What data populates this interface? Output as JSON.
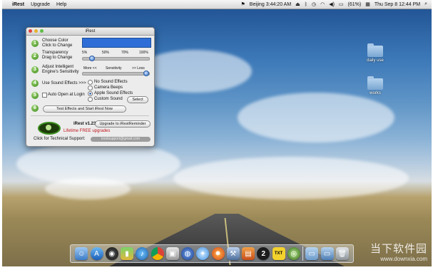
{
  "menubar": {
    "app": "iRest",
    "items": [
      "Upgrade",
      "Help"
    ],
    "clock_city": "Beijing 3:44:20 AM",
    "battery": "(61%)",
    "datetime": "Thu Sep 8  12:44 PM"
  },
  "desktop": {
    "icons": [
      {
        "label": "daily use"
      },
      {
        "label": "works"
      }
    ]
  },
  "window": {
    "title": "iRest",
    "steps": [
      {
        "num": "1",
        "label": "Choose Color\nClick to Change"
      },
      {
        "num": "2",
        "label": "Transparency\nDrag to Change"
      },
      {
        "num": "3",
        "label": "Adjust Intelligent\nEngine's Sensitivity"
      },
      {
        "num": "4",
        "label": "Use Sound Effects  >>>"
      },
      {
        "num": "5",
        "label": "Auto Open at Login"
      },
      {
        "num": "6"
      }
    ],
    "transparency": {
      "ticks": [
        "5%",
        "50%",
        "70%",
        "100%"
      ],
      "value_fraction": 0.12
    },
    "sensitivity": {
      "left": "More <<",
      "mid": "Sensitivity",
      "right": ">>  Less",
      "value_fraction": 1.0
    },
    "sound_options": [
      {
        "label": "No Sound Effects",
        "selected": false
      },
      {
        "label": "Camera Beeps",
        "selected": false
      },
      {
        "label": "Apple Sound Effects",
        "selected": true
      },
      {
        "label": "Custom Sound",
        "selected": false
      }
    ],
    "select_button": "Select",
    "test_button": "Test Effects and Start iRest Now",
    "app_name": "iRest  v1.23",
    "upgrade_button": "Upgrade to iRestReminder",
    "lifetime": "Lifetime FREE upgrades",
    "support_label": "Click for Technical Support:",
    "support_email": "irestsupport@gmail.com",
    "color_value": "#2f6ed6"
  },
  "dock": {
    "icons": [
      "finder-icon",
      "appstore-icon",
      "dashboard-icon",
      "launchpad-icon",
      "itunes-icon",
      "chrome-icon",
      "preview-icon",
      "network-icon",
      "safari-icon",
      "firefox-icon",
      "xcode-icon",
      "photos-icon",
      "2-icon",
      "txt-icon",
      "irest-icon",
      "folder-icon",
      "finder2-icon",
      "trash-icon"
    ],
    "icon_2": "2",
    "icon_txt": "TXT"
  },
  "watermark": {
    "title": "当下软件园",
    "url": "www.downxia.com"
  }
}
